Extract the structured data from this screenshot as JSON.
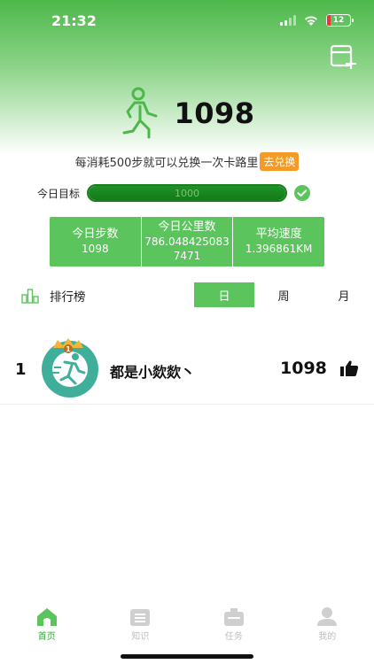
{
  "status_bar": {
    "time": "21:32",
    "battery_level": "12"
  },
  "header": {
    "add_icon": "calendar-plus-icon"
  },
  "hero": {
    "icon": "walking-person-icon",
    "steps": "1098"
  },
  "exchange": {
    "text": "每消耗500步就可以兑换一次卡路里",
    "button_label": "去兑换"
  },
  "goal": {
    "label": "今日目标",
    "target": "1000",
    "progress_fraction": 1.0,
    "check_icon": "check-circle-icon"
  },
  "stats": [
    {
      "title": "今日步数",
      "value": "1098"
    },
    {
      "title": "今日公里数",
      "value": "786.0484250837471"
    },
    {
      "title": "平均速度",
      "value": "1.396861KM"
    }
  ],
  "ranking": {
    "icon": "bar-chart-icon",
    "title": "排行榜",
    "tabs": [
      {
        "label": "日",
        "active": true
      },
      {
        "label": "周",
        "active": false
      },
      {
        "label": "月",
        "active": false
      }
    ],
    "entries": [
      {
        "rank": "1",
        "badge": "1",
        "name": "都是小欻欻丶",
        "score": "1098",
        "like_icon": "thumbs-up-icon"
      }
    ]
  },
  "tabbar": [
    {
      "label": "首页",
      "icon": "home-icon",
      "active": true
    },
    {
      "label": "知识",
      "icon": "book-icon",
      "active": false
    },
    {
      "label": "任务",
      "icon": "briefcase-icon",
      "active": false
    },
    {
      "label": "我的",
      "icon": "person-icon",
      "active": false
    }
  ],
  "colors": {
    "primary": "#5cc45d",
    "accent": "#f39b26",
    "progress": "#1f9225"
  }
}
